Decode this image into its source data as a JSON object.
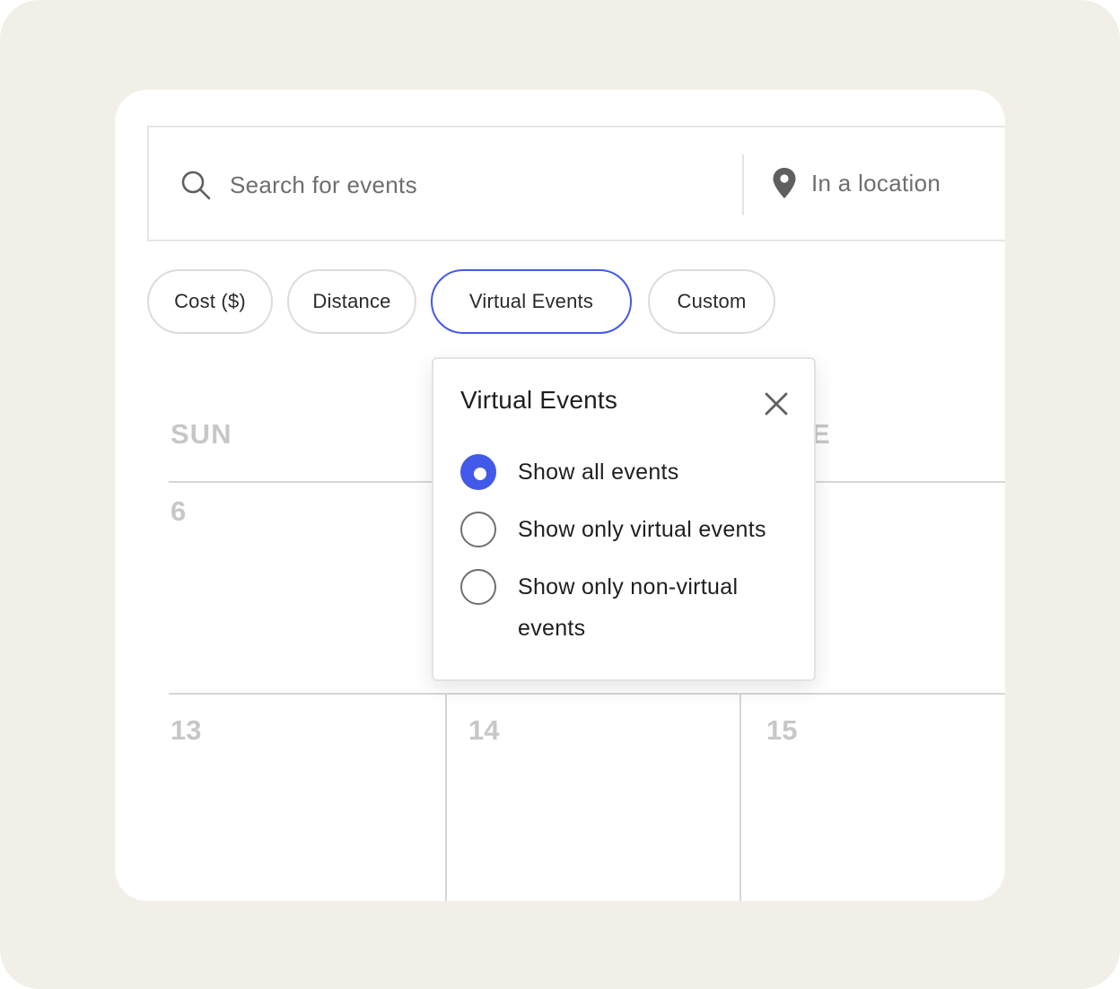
{
  "search": {
    "placeholder": "Search for events",
    "location_placeholder": "In a location"
  },
  "filters": [
    {
      "label": "Cost ($)"
    },
    {
      "label": "Distance"
    },
    {
      "label": "Virtual Events",
      "active": true
    },
    {
      "label": "Custom"
    }
  ],
  "calendar": {
    "day_headers": [
      "SUN",
      "E"
    ],
    "dates": [
      "6",
      "13",
      "14",
      "15"
    ]
  },
  "popover": {
    "title": "Virtual Events",
    "options": [
      {
        "label": "Show all events",
        "selected": true
      },
      {
        "label": "Show only virtual events",
        "selected": false
      },
      {
        "label": "Show only non-virtual events",
        "selected": false
      }
    ]
  },
  "colors": {
    "accent": "#4259ea",
    "frame_bg": "#f2eee8",
    "muted_text": "#c7c7c7"
  }
}
